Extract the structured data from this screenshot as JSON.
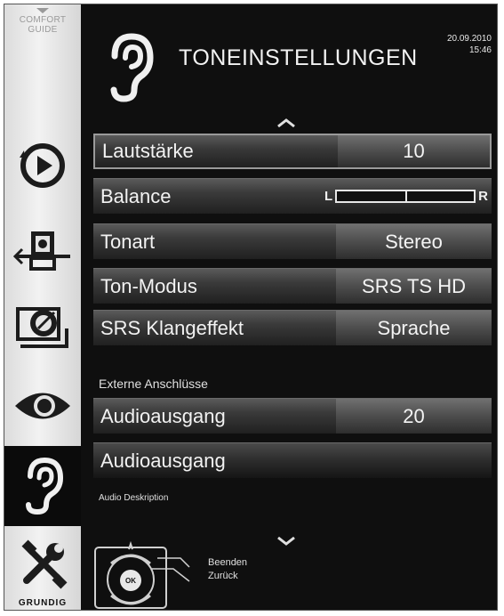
{
  "sidebar": {
    "comfort_line1": "COMFORT",
    "comfort_line2": "GUIDE",
    "brand": "GRUNDIG",
    "items": [
      {
        "icon": "playback-icon"
      },
      {
        "icon": "source-connection-icon"
      },
      {
        "icon": "satellite-dish-icon"
      },
      {
        "icon": "eye-icon"
      },
      {
        "icon": "ear-icon",
        "active": true
      },
      {
        "icon": "tools-icon"
      }
    ]
  },
  "header": {
    "title": "TONEINSTELLUNGEN",
    "date": "20.09.2010",
    "time": "15:46",
    "icon": "ear-icon"
  },
  "menu": {
    "volume": {
      "label": "Lautstärke",
      "value": "10"
    },
    "balance": {
      "label": "Balance",
      "left": "L",
      "right": "R",
      "level": 0.5
    },
    "tonart": {
      "label": "Tonart",
      "value": "Stereo"
    },
    "tonmodus": {
      "label": "Ton-Modus",
      "value": "SRS TS HD"
    },
    "srs": {
      "label": "SRS Klangeffekt",
      "value": "Sprache"
    },
    "external_heading": "Externe Anschlüsse",
    "audioout1": {
      "label": "Audioausgang",
      "value": "20"
    },
    "audioout2": {
      "label": "Audioausgang"
    },
    "audio_description": "Audio Deskription"
  },
  "footer": {
    "ok_label": "OK",
    "exit_label": "Beenden",
    "back_label": "Zurück"
  },
  "colors": {
    "background": "#0f0f0f",
    "sidebar": "#e6e6e6",
    "row": "#3a3a3a",
    "text": "#f2f2f2"
  }
}
